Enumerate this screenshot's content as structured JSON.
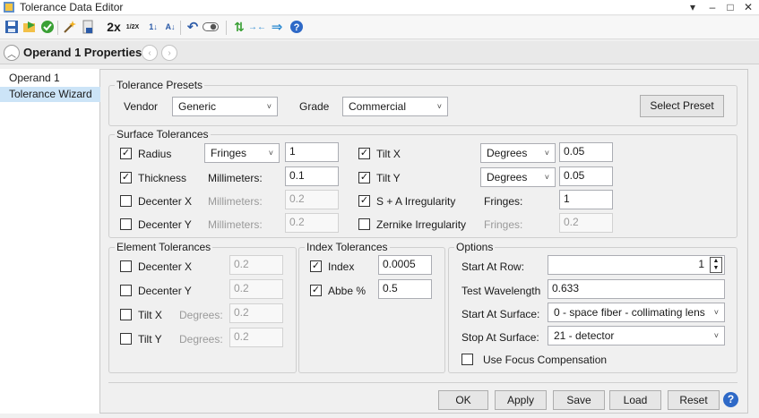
{
  "window": {
    "title": "Tolerance Data Editor",
    "controls": [
      "▾",
      "–",
      "□",
      "✕"
    ]
  },
  "toolbar": {
    "zoom_2x": "2x",
    "zoom_half": "1/2X"
  },
  "header": {
    "title": "Operand  1 Properties"
  },
  "left_list": {
    "items": [
      "Operand 1",
      "Tolerance Wizard"
    ],
    "selected_index": 1
  },
  "presets": {
    "legend": "Tolerance Presets",
    "vendor_label": "Vendor",
    "vendor_value": "Generic",
    "grade_label": "Grade",
    "grade_value": "Commercial",
    "select_button": "Select Preset"
  },
  "surface": {
    "legend": "Surface Tolerances",
    "radius": {
      "label": "Radius",
      "checked": true,
      "unit": "Fringes",
      "value": "1"
    },
    "thickness": {
      "label": "Thickness",
      "checked": true,
      "unit": "Millimeters:",
      "value": "0.1"
    },
    "decenter_x": {
      "label": "Decenter X",
      "checked": false,
      "unit": "Millimeters:",
      "value": "0.2"
    },
    "decenter_y": {
      "label": "Decenter Y",
      "checked": false,
      "unit": "Millimeters:",
      "value": "0.2"
    },
    "tilt_x": {
      "label": "Tilt X",
      "checked": true,
      "unit": "Degrees",
      "value": "0.05"
    },
    "tilt_y": {
      "label": "Tilt Y",
      "checked": true,
      "unit": "Degrees",
      "value": "0.05"
    },
    "sa_irr": {
      "label": "S + A Irregularity",
      "checked": true,
      "unit": "Fringes:",
      "value": "1"
    },
    "zernike": {
      "label": "Zernike Irregularity",
      "checked": false,
      "unit": "Fringes:",
      "value": "0.2"
    }
  },
  "element": {
    "legend": "Element Tolerances",
    "decenter_x": {
      "label": "Decenter X",
      "checked": false,
      "value": "0.2"
    },
    "decenter_y": {
      "label": "Decenter Y",
      "checked": false,
      "value": "0.2"
    },
    "tilt_x": {
      "label": "Tilt X",
      "checked": false,
      "unit": "Degrees:",
      "value": "0.2"
    },
    "tilt_y": {
      "label": "Tilt Y",
      "checked": false,
      "unit": "Degrees:",
      "value": "0.2"
    }
  },
  "index": {
    "legend": "Index Tolerances",
    "index": {
      "label": "Index",
      "checked": true,
      "value": "0.0005"
    },
    "abbe": {
      "label": "Abbe %",
      "checked": true,
      "value": "0.5"
    }
  },
  "options": {
    "legend": "Options",
    "start_row_label": "Start At Row:",
    "start_row_value": "1",
    "wavelength_label": "Test Wavelength",
    "wavelength_value": "0.633",
    "start_surface_label": "Start At Surface:",
    "start_surface_value": "0 - space fiber - collimating lens",
    "stop_surface_label": "Stop At Surface:",
    "stop_surface_value": "21 - detector",
    "focus_comp_label": "Use Focus Compensation",
    "focus_comp_checked": false
  },
  "buttons": {
    "ok": "OK",
    "apply": "Apply",
    "save": "Save",
    "load": "Load",
    "reset": "Reset"
  },
  "colors": {
    "selection": "#cce4f7",
    "help_blue": "#2e69c7",
    "accent_green": "#3aa035"
  }
}
